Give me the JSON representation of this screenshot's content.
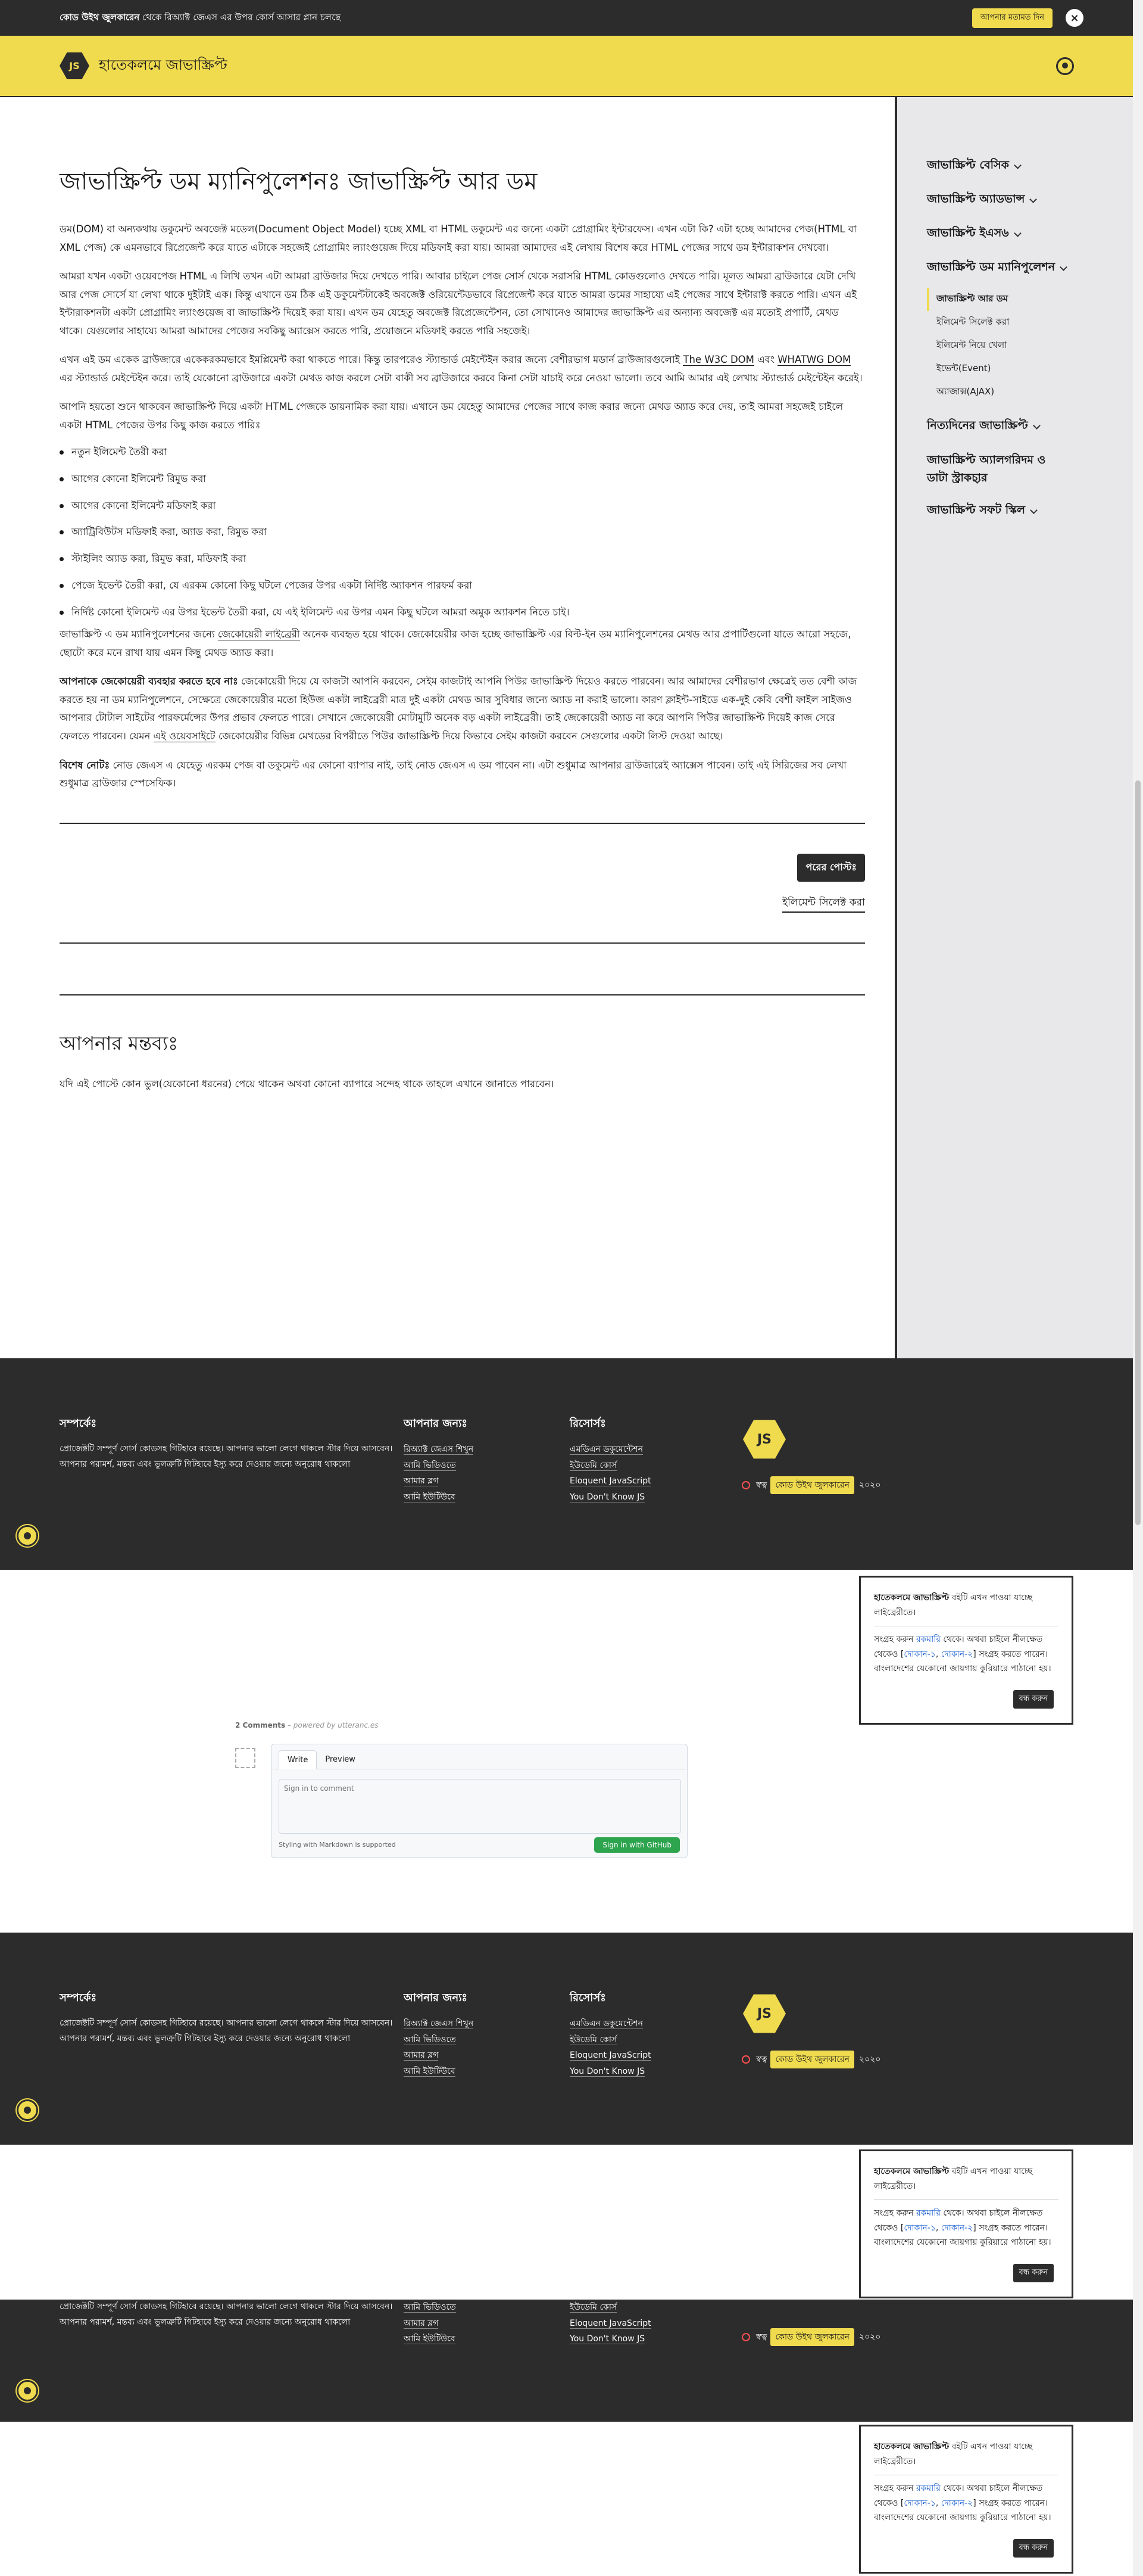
{
  "announcement": {
    "text_bold": "কোড উইথ জুলকারেন",
    "text_rest": " থেকে রিঅ্যাক্ট জেএস এর উপর কোর্স আসার প্লান চলছে",
    "button": "আপনার মতামত দিন",
    "close": "×"
  },
  "header": {
    "logo": "JS",
    "title": "হাতেকলমে জাভাস্ক্রিপ্ট"
  },
  "sidebar": {
    "items": [
      {
        "label": "জাভাস্ক্রিপ্ট বেসিক"
      },
      {
        "label": "জাভাস্ক্রিপ্ট অ্যাডভান্স"
      },
      {
        "label": "জাভাস্ক্রিপ্ট ইএস৬"
      },
      {
        "label": "জাভাস্ক্রিপ্ট ডম ম্যানিপুলেশন"
      },
      {
        "label": "নিত্যদিনের জাভাস্ক্রিপ্ট"
      },
      {
        "label": "জাভাস্ক্রিপ্ট অ্যালগরিদম ও ডাটা স্ট্রাকচার"
      },
      {
        "label": "জাভাস্ক্রিপ্ট সফট স্কিল"
      }
    ],
    "sub_items": [
      {
        "label": "জাভাস্ক্রিপ্ট আর ডম"
      },
      {
        "label": "ইলিমেন্ট সিলেক্ট করা"
      },
      {
        "label": "ইলিমেন্ট নিয়ে খেলা"
      },
      {
        "label": "ইভেন্ট(Event)"
      },
      {
        "label": "অ্যাজাক্স(AJAX)"
      }
    ]
  },
  "article": {
    "title": "জাভাস্ক্রিপ্ট ডম ম্যানিপুলেশনঃ জাভাস্ক্রিপ্ট আর ডম",
    "p1": "ডম(DOM) বা অন্যকথায় ডকুমেন্ট অবজেক্ট মডেল(Document Object Model) হচ্ছে XML বা HTML ডকুমেন্ট এর জন্যে একটা প্রোগ্রামিং ইন্টারফেস। এখন এটা কি? এটা হচ্ছে আমাদের পেজ(HTML বা XML পেজ) কে এমনভাবে রিপ্রেজেন্ট করে যাতে এটাকে সহজেই প্রোগ্রামিং ল্যাংগুয়েজ দিয়ে মডিফাই করা যায়। আমরা আমাদের এই লেখায় বিশেষ করে HTML পেজের সাথে ডম ইন্টারাকশন দেখবো।",
    "p2": "আমরা যখন একটা ওয়েবপেজ HTML এ লিখি তখন এটা আমরা ব্রাউজার দিয়ে দেখতে পারি। আবার চাইলে পেজ সোর্স থেকে সরাসরি HTML কোডগুলোও দেখতে পারি। মূলত আমরা ব্রাউজারে যেটা দেখি আর পেজ সোর্সে যা লেখা থাকে দুইটাই এক। কিন্তু এখানে ডম ঠিক এই ডকুমেন্টটাকেই অবজেক্ট ওরিয়েন্টেডভাবে রিপ্রেজেন্ট করে যাতে আমরা ডমের সাহায্যে এই পেজের সাথে ইন্টারাক্ট করতে পারি। এখন এই ইন্টারাকশনটা একটা প্রোগ্রামিং ল্যাংগুয়েজ বা জাভাস্ক্রিপ্ট দিয়েই করা যায়। এখন ডম যেহেতু অবজেক্ট রিপ্রেজেন্টেশন, তো সোখানেও আমাদের জাভাস্ক্রিপ্ট এর অন্যান্য অবজেক্ট এর মতোই প্রপার্টি, মেথড থাকে। যেগুলোর সাহায্যে আমরা আমাদের পেজের সবকিছু অ্যাক্সেস করতে পারি, প্রয়োজনে মডিফাই করতে পারি সহজেই।",
    "p3_a": "এখন এই ডম একেক ব্রাউজারে একেকরকমভাবে ইমপ্লিমেন্ট করা থাকতে পারে। কিন্তু তারপরেও স্ট্যান্ডার্ড মেইন্টেইন করার জন্যে বেশীরভাগ মডার্ন ব্রাউজারগুলোই ",
    "p3_link1": "The W3C DOM",
    "p3_b": " এবং ",
    "p3_link2": "WHATWG DOM",
    "p3_c": " এর স্ট্যান্ডার্ড মেইন্টেইন করে। তাই যেকোনো ব্রাউজারে একটা মেথড কাজ করলে সেটা বাকী সব ব্রাউজারে করবে কিনা সেটা যাচাই করে নেওয়া ভালো। তবে আমি আমার এই লেখায় স্ট্যান্ডার্ড মেইন্টেইন করেই।",
    "p4": "আপনি হয়তো শুনে থাকবেন জাভাস্ক্রিপ্ট দিয়ে একটা HTML পেজকে ডায়নামিক করা যায়। এখানে ডম যেহেতু আমাদের পেজের সাথে কাজ করার জন্যে মেথড অ্যাড করে দেয়, তাই আমরা সহজেই চাইলে একটা HTML পেজের উপর কিছু কাজ করতে পারিঃ",
    "list": [
      "নতুন ইলিমেন্ট তৈরী করা",
      "আগের কোনো ইলিমেন্ট রিমুভ করা",
      "আগের কোনো ইলিমেন্ট মডিফাই করা",
      "অ্যাট্রিবিউটস মডিফাই করা, অ্যাড করা, রিমুভ করা",
      "স্টাইলিং অ্যাড করা, রিমুভ করা, মডিফাই করা",
      "পেজে ইভেন্ট তৈরী করা, যে এরকম কোনো কিছু ঘটলে পেজের উপর একটা নির্দিষ্ট অ্যাকশন পারফর্ম করা",
      "নির্দিষ্ট কোনো ইলিমেন্ট এর উপর ইভেন্ট তৈরী করা, যে এই ইলিমেন্ট এর উপর এমন কিছু ঘটলে আমরা অমুক অ্যাকশন নিতে চাই।"
    ],
    "p5_a": "জাভাস্ক্রিপ্ট এ ডম ম্যানিপুলেশনের জন্যে ",
    "p5_link": "জেকোয়েরী লাইব্রেরী",
    "p5_b": " অনেক ব্যবহৃত হয়ে থাকে। জেকোয়েরীর কাজ হচ্ছে জাভাস্ক্রিপ্ট এর বিল্ট-ইন ডম ম্যানিপুলেশনের মেথড আর প্রপার্টিগুলো যাতে আরো সহজে, ছোটো করে মনে রাখা যায় এমন কিছু মেথড অ্যাড করা।",
    "p6_bold": "আপনাকে জেকোয়েরী ব্যবহার করতে হবে নাঃ",
    "p6_a": " জেকোয়েরী দিয়ে যে কাজটা আপনি করবেন, সেইম কাজটাই আপনি পিউর জাভাস্ক্রিপ্ট দিয়েও করতে পারবেন। আর আমাদের বেশীরভাগ ক্ষেত্রেই তত বেশী কাজ করতে হয় না ডম ম্যানিপুলেশনে, সেক্ষেত্রে জেকোয়েরীর মতো হিউজ একটা লাইব্রেরী মাত্র দুই একটা মেথড আর সুবিধার জন্যে অ্যাড না করাই ভালো। কারণ ক্লাইন্ট-সাইডে এক-দুই কেবি বেশী ফাইল সাইজও আপনার টোটাল সাইটের পারফর্মেন্সের উপর প্রভাব ফেলতে পারে। সেখানে জেকোয়েরী মোটামুটি অনেক বড় একটা লাইব্রেরী। তাই জেকোয়েরী অ্যাড না করে আপনি পিউর জাভাস্ক্রিপ্ট দিয়েই কাজ সেরে ফেলতে পারবেন। যেমন ",
    "p6_link": "এই ওয়েবসাইটে",
    "p6_b": " জেকোয়েরীর বিভিন্ন মেথডের বিপরীতে পিউর জাভাস্ক্রিপ্ট দিয়ে কিভাবে সেইম কাজটা করবেন সেগুলোর একটা লিস্ট দেওয়া আছে।",
    "p7_bold": "বিশেষ নোটঃ",
    "p7_a": " নোড জেএস এ যেহেতু এরকম পেজ বা ডকুমেন্ট এর কোনো ব্যাপার নাই, তাই নোড জেএস এ ডম পাবেন না। এটা শুধুমাত্র আপনার ব্রাউজারেই অ্যাক্সেস পাবেন। তাই এই সিরিজের সব লেখা শুধুমাত্র ব্রাউজার স্পেসেফিক।",
    "next_button": "পরের পোস্টঃ",
    "next_link": "ইলিমেন্ট সিলেক্ট করা",
    "comments_title": "আপনার মন্তব্যঃ",
    "comments_text": "যদি এই পোস্টে কোন ভুল(যেকোনো ধরনের) পেয়ে থাকেন অথবা কোনো ব্যাপারে সন্দেহ থাকে তাহলে এখানে জানাতে পারবেন।"
  },
  "footer": {
    "about_title": "সম্পর্কেঃ",
    "about_text": "প্রোজেক্টটি সম্পূর্ণ সোর্স কোডসহ গিটহাবে রয়েছে। আপনার ভালো লেগে থাকলে স্টার দিয়ে আসবেন। আপনার পরামর্শ, মন্তব্য এবং ভুলত্রুটি গিটহাবে ইস্যু করে দেওয়ার জন্যে অনুরোধ থাকলো",
    "for_you_title": "আপনার জন্যঃ",
    "for_you_links": [
      "রিঅ্যাক্ট জেএস শিখুন",
      "আমি ভিডিওতে",
      "আমার ব্লগ",
      "আমি ইউটিউবে"
    ],
    "resources_title": "রিসোর্সঃ",
    "resources_links": [
      "এমডিএন ডকুমেন্টেশন",
      "ইউডেমি কোর্স",
      "Eloquent JavaScript",
      "You Don't Know JS"
    ],
    "logo": "JS",
    "copyright_prefix": "স্বত্ব",
    "copyright_name": "কোড উইথ জুলকারেন",
    "copyright_year": "২০২০"
  },
  "notice": {
    "title_bold": "হাতেকলমে জাভাস্ক্রিপ্ট",
    "title_rest": " বইটি এখন পাওয়া যাচ্ছে লাইব্রেরীতে।",
    "body_a": "সংগ্রহ করুন ",
    "body_link1": "রকমারি",
    "body_b": " থেকে। অথবা চাইলে নীলক্ষেত থেকেও [",
    "body_link2": "দোকান-১",
    "body_c": ", ",
    "body_link3": "দোকান-২",
    "body_d": "] সংগ্রহ করতে পারেন। বাংলাদেশের যেকোনো জায়গায় কুরিয়ারে পাঠানো হয়।",
    "close": "বন্ধ করুন"
  },
  "utterances": {
    "count": "2 Comments",
    "powered": " – powered by utteranc.es",
    "tab_write": "Write",
    "tab_preview": "Preview",
    "placeholder": "Sign in to comment",
    "markdown_note": "Styling with Markdown is supported",
    "signin": "Sign in with GitHub"
  }
}
